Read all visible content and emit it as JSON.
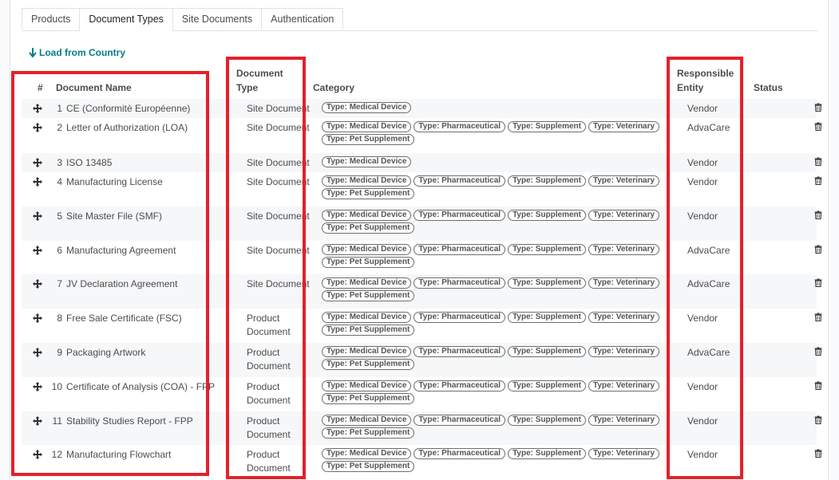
{
  "tabs": [
    "Products",
    "Document Types",
    "Site Documents",
    "Authentication"
  ],
  "active_tab": 1,
  "load_button": "Load from Country",
  "columns": {
    "num": "#",
    "name": "Document Name",
    "type_line1": "Document",
    "type_line2": "Type",
    "category": "Category",
    "resp_line1": "Responsible",
    "resp_line2": "Entity",
    "status": "Status"
  },
  "rows": [
    {
      "num": "1",
      "name": "CE (Conformitè Européenne)",
      "type": [
        "Site Document"
      ],
      "tags": [
        "Type: Medical Device"
      ],
      "entity": "Vendor"
    },
    {
      "num": "2",
      "name": "Letter of Authorization (LOA)",
      "type": [
        "Site Document"
      ],
      "tags": [
        "Type: Medical Device",
        "Type: Pharmaceutical",
        "Type: Supplement",
        "Type: Veterinary",
        "Type: Pet Supplement"
      ],
      "entity": "AdvaCare"
    },
    {
      "num": "3",
      "name": "ISO 13485",
      "type": [
        "Site Document"
      ],
      "tags": [
        "Type: Medical Device"
      ],
      "entity": "Vendor"
    },
    {
      "num": "4",
      "name": "Manufacturing License",
      "type": [
        "Site Document"
      ],
      "tags": [
        "Type: Medical Device",
        "Type: Pharmaceutical",
        "Type: Supplement",
        "Type: Veterinary",
        "Type: Pet Supplement"
      ],
      "entity": "Vendor"
    },
    {
      "num": "5",
      "name": "Site Master File (SMF)",
      "type": [
        "Site Document"
      ],
      "tags": [
        "Type: Medical Device",
        "Type: Pharmaceutical",
        "Type: Supplement",
        "Type: Veterinary",
        "Type: Pet Supplement"
      ],
      "entity": "Vendor"
    },
    {
      "num": "6",
      "name": "Manufacturing Agreement",
      "type": [
        "Site Document"
      ],
      "tags": [
        "Type: Medical Device",
        "Type: Pharmaceutical",
        "Type: Supplement",
        "Type: Veterinary",
        "Type: Pet Supplement"
      ],
      "entity": "AdvaCare"
    },
    {
      "num": "7",
      "name": "JV Declaration Agreement",
      "type": [
        "Site Document"
      ],
      "tags": [
        "Type: Medical Device",
        "Type: Pharmaceutical",
        "Type: Supplement",
        "Type: Veterinary",
        "Type: Pet Supplement"
      ],
      "entity": "AdvaCare"
    },
    {
      "num": "8",
      "name": "Free Sale Certificate (FSC)",
      "type": [
        "Product",
        "Document"
      ],
      "tags": [
        "Type: Medical Device",
        "Type: Pharmaceutical",
        "Type: Supplement",
        "Type: Veterinary",
        "Type: Pet Supplement"
      ],
      "entity": "Vendor"
    },
    {
      "num": "9",
      "name": "Packaging Artwork",
      "type": [
        "Product",
        "Document"
      ],
      "tags": [
        "Type: Medical Device",
        "Type: Pharmaceutical",
        "Type: Supplement",
        "Type: Veterinary",
        "Type: Pet Supplement"
      ],
      "entity": "AdvaCare"
    },
    {
      "num": "10",
      "name": "Certificate of Analysis (COA) - FPP",
      "type": [
        "Product",
        "Document"
      ],
      "tags": [
        "Type: Medical Device",
        "Type: Pharmaceutical",
        "Type: Supplement",
        "Type: Veterinary",
        "Type: Pet Supplement"
      ],
      "entity": "Vendor"
    },
    {
      "num": "11",
      "name": "Stability Studies Report - FPP",
      "type": [
        "Product",
        "Document"
      ],
      "tags": [
        "Type: Medical Device",
        "Type: Pharmaceutical",
        "Type: Supplement",
        "Type: Veterinary",
        "Type: Pet Supplement"
      ],
      "entity": "Vendor"
    },
    {
      "num": "12",
      "name": "Manufacturing Flowchart",
      "type": [
        "Product",
        "Document"
      ],
      "tags": [
        "Type: Medical Device",
        "Type: Pharmaceutical",
        "Type: Supplement",
        "Type: Veterinary",
        "Type: Pet Supplement"
      ],
      "entity": "Vendor"
    }
  ],
  "colors": {
    "accent": "#017e84",
    "highlight": "#e5202a",
    "tag_border": "#6e6e6e"
  },
  "icons": {
    "drag": "drag-handle-icon",
    "delete": "trash-icon",
    "load": "arrow-down-icon"
  }
}
